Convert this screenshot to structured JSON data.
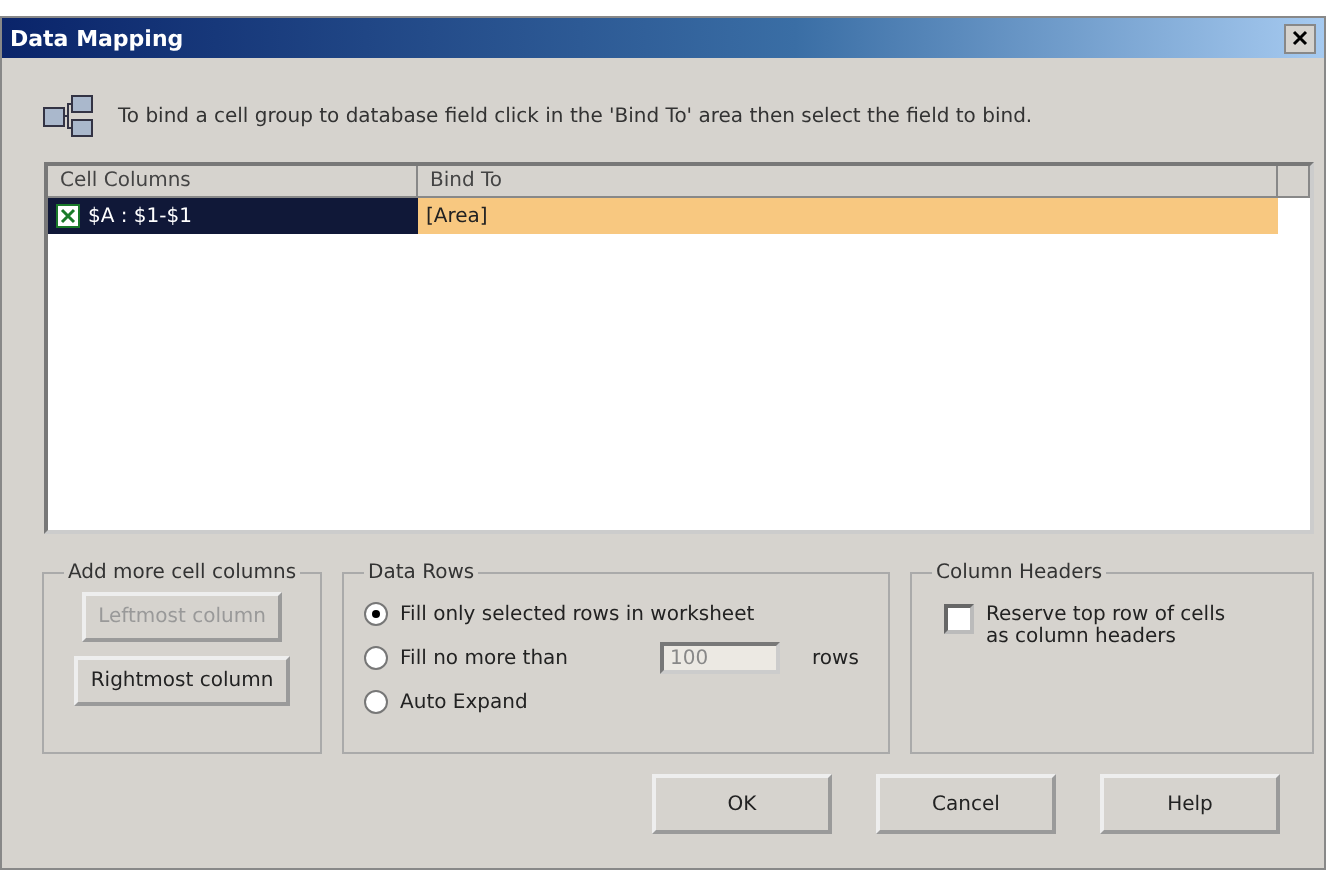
{
  "window": {
    "title": "Data Mapping"
  },
  "instruction": "To bind a cell group to database field click in the 'Bind To' area then select the field to bind.",
  "table": {
    "columns": [
      "Cell Columns",
      "Bind To"
    ],
    "rows": [
      {
        "cell": "$A : $1-$1",
        "bind": "[Area]",
        "selected": true
      }
    ]
  },
  "add_columns": {
    "title": "Add more cell columns",
    "buttons": [
      {
        "label": "Leftmost column",
        "disabled": true
      },
      {
        "label": "Rightmost column",
        "disabled": false
      }
    ]
  },
  "data_rows": {
    "title": "Data Rows",
    "options": [
      {
        "label": "Fill only selected rows in worksheet",
        "selected": true
      },
      {
        "label": "Fill no more than",
        "selected": false
      },
      {
        "label": "Auto Expand",
        "selected": false
      }
    ],
    "max_rows": {
      "value": "100",
      "disabled": true
    },
    "unit": "rows"
  },
  "column_headers": {
    "title": "Column Headers",
    "checkbox": {
      "label": "Reserve top row of cells as column headers",
      "checked": false
    }
  },
  "buttons": [
    "OK",
    "Cancel",
    "Help"
  ]
}
